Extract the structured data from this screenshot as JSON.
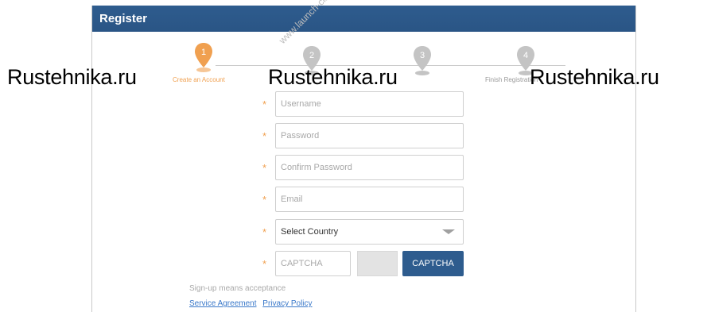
{
  "window": {
    "title": "Register"
  },
  "steps": [
    {
      "number": "1",
      "label": "Create an Account",
      "active": true
    },
    {
      "number": "2",
      "label": "",
      "active": false
    },
    {
      "number": "3",
      "label": "",
      "active": false
    },
    {
      "number": "4",
      "label": "Finish Registration",
      "active": false
    }
  ],
  "form": {
    "username_placeholder": "Username",
    "password_placeholder": "Password",
    "confirm_password_placeholder": "Confirm Password",
    "email_placeholder": "Email",
    "country_value": "Select Country",
    "captcha_placeholder": "CAPTCHA",
    "captcha_button": "CAPTCHA",
    "required_mark": "*"
  },
  "footer": {
    "note": "Sign-up means acceptance",
    "service_agreement": "Service Agreement",
    "privacy_policy": "Privacy Policy"
  },
  "watermarks": {
    "left": "Rustehnika.ru",
    "center": "Rustehnika.ru",
    "right": "Rustehnika.ru",
    "diagonal": "www.launch-cis.ru"
  },
  "colors": {
    "accent": "#2e5c8e",
    "active_step": "#f0a050",
    "inactive_step": "#c4c4c4"
  }
}
